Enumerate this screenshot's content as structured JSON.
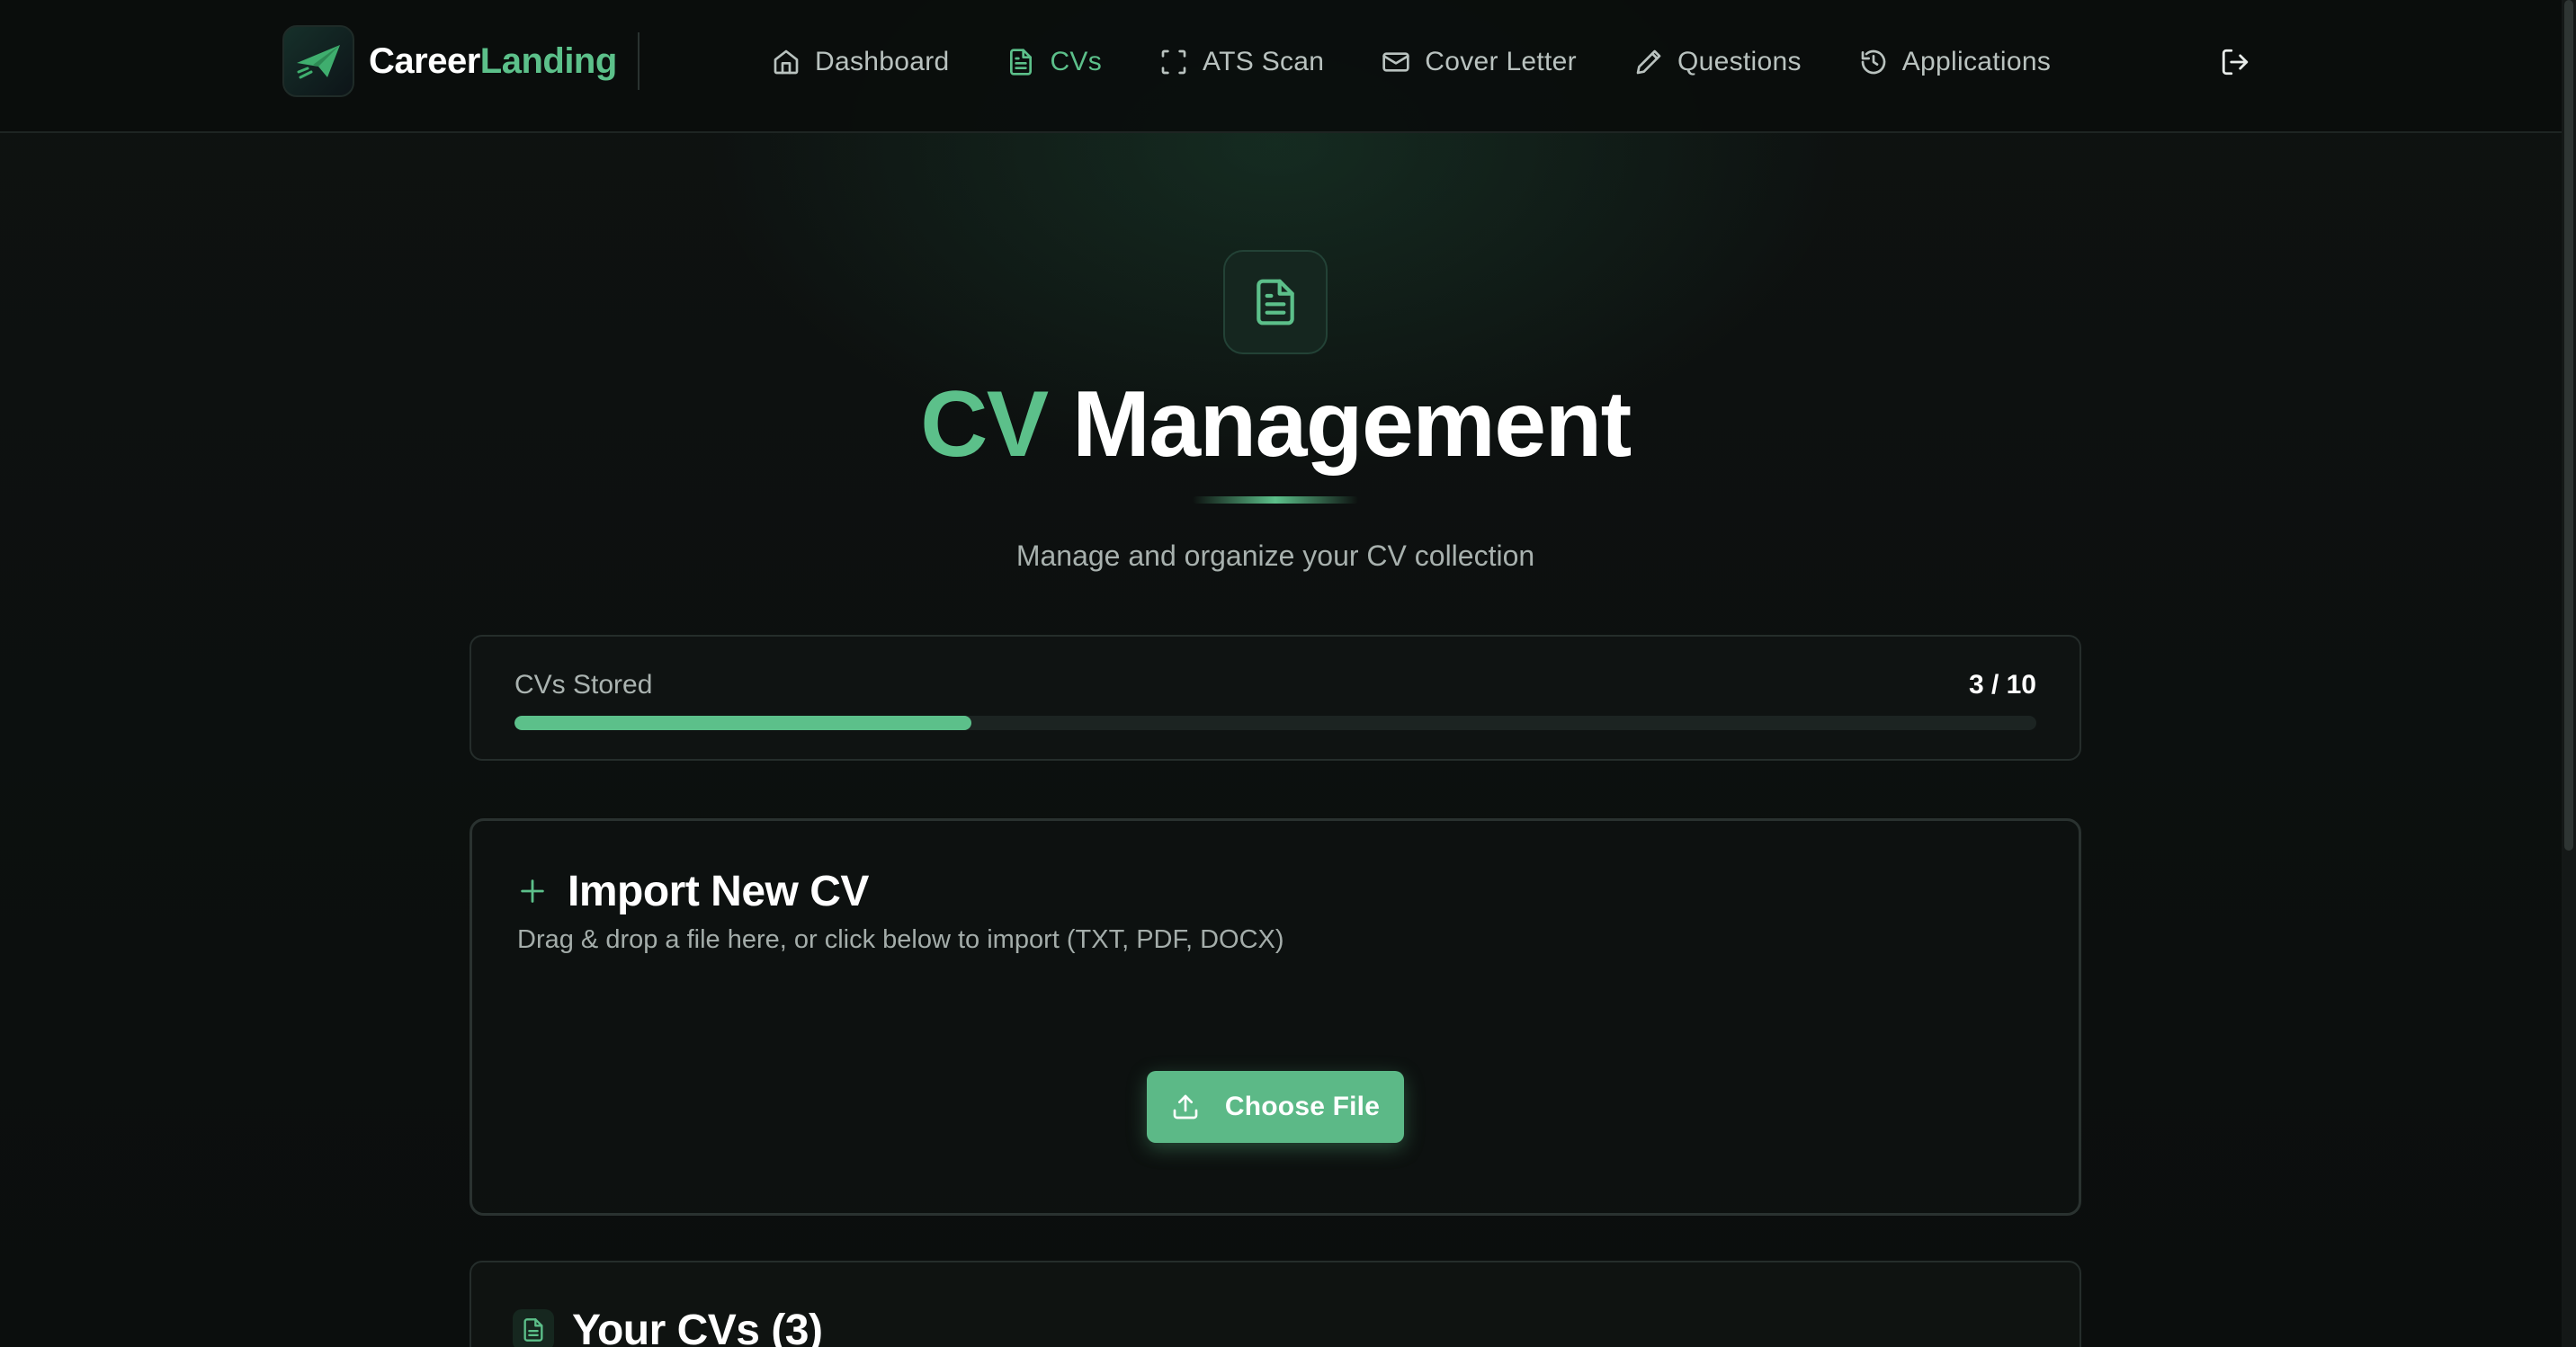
{
  "brand": {
    "part1": "Career",
    "part2": "Landing"
  },
  "nav": {
    "items": [
      {
        "label": "Dashboard",
        "icon": "home-icon",
        "active": false
      },
      {
        "label": "CVs",
        "icon": "document-icon",
        "active": true
      },
      {
        "label": "ATS Scan",
        "icon": "scan-icon",
        "active": false
      },
      {
        "label": "Cover Letter",
        "icon": "mail-icon",
        "active": false
      },
      {
        "label": "Questions",
        "icon": "pencil-icon",
        "active": false
      },
      {
        "label": "Applications",
        "icon": "history-icon",
        "active": false
      }
    ],
    "logout_icon": "logout-icon"
  },
  "hero": {
    "title_accent": "CV",
    "title_rest": "Management",
    "subtitle": "Manage and organize your CV collection"
  },
  "stored": {
    "label": "CVs Stored",
    "count": "3 / 10",
    "used": 3,
    "max": 10
  },
  "import": {
    "title": "Import New CV",
    "description": "Drag & drop a file here, or click below to import (TXT, PDF, DOCX)",
    "button_label": "Choose File"
  },
  "cvs": {
    "title": "Your CVs (3)"
  },
  "colors": {
    "accent": "#5cc08a",
    "background": "#0c0f0e",
    "button": "#5cb987"
  }
}
